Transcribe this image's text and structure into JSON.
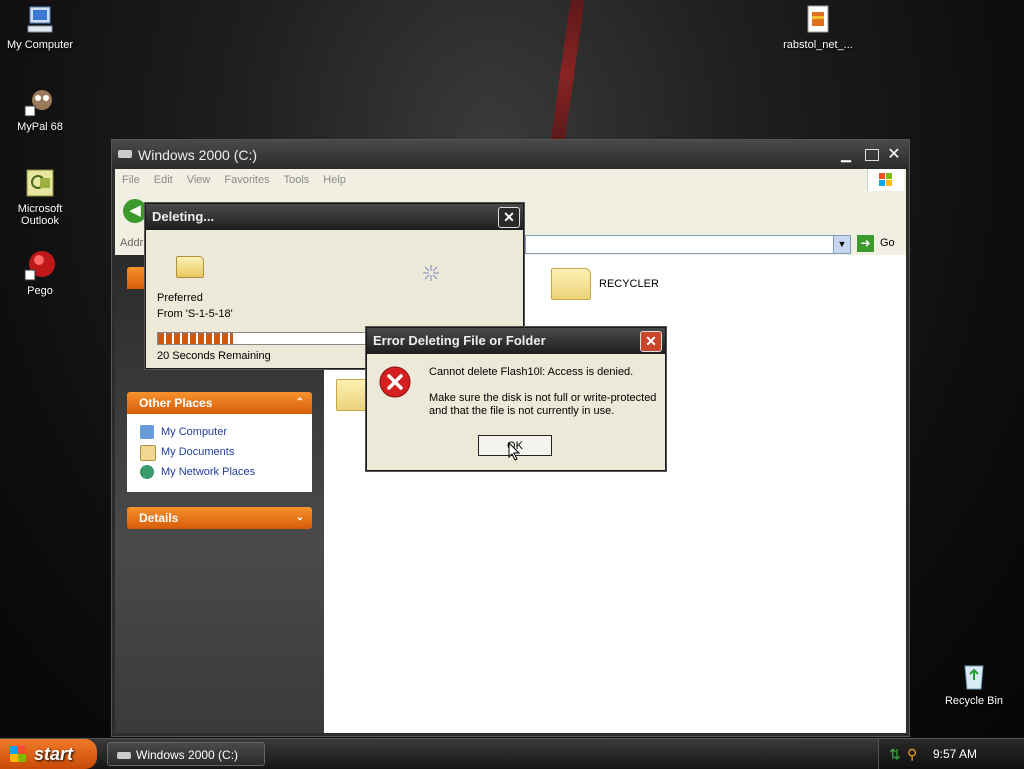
{
  "desktop": {
    "icons": [
      {
        "label": "My Computer"
      },
      {
        "label": "MyPal 68"
      },
      {
        "label": "Microsoft Outlook"
      },
      {
        "label": "Pego"
      },
      {
        "label": "rabstol_net_..."
      },
      {
        "label": "Recycle Bin"
      }
    ]
  },
  "explorer": {
    "title": "Windows 2000 (C:)",
    "menu": [
      "File",
      "Edit",
      "View",
      "Favorites",
      "Tools",
      "Help"
    ],
    "address_label": "Addr",
    "go_label": "Go",
    "panels": {
      "other_places": {
        "title": "Other Places",
        "items": [
          "My Computer",
          "My Documents",
          "My Network Places"
        ]
      },
      "details": {
        "title": "Details"
      }
    },
    "files": [
      {
        "name": "RECYCLER"
      }
    ]
  },
  "deleting_dialog": {
    "title": "Deleting...",
    "file_name": "Preferred",
    "from_text": "From 'S-1-5-18'",
    "progress": 0.3,
    "remaining": "20 Seconds Remaining"
  },
  "error_dialog": {
    "title": "Error Deleting File or Folder",
    "message": "Cannot delete Flash10l: Access is denied.",
    "detail_line1": "Make sure the disk is not full or write-protected",
    "detail_line2": "and that the file is not currently in use.",
    "ok_label": "OK"
  },
  "taskbar": {
    "start_label": "start",
    "task_label": "Windows 2000 (C:)",
    "clock": "9:57 AM"
  },
  "colors": {
    "accent_orange": "#e8711a",
    "error_red": "#d42020",
    "progress_fill": "#c85a1a"
  }
}
